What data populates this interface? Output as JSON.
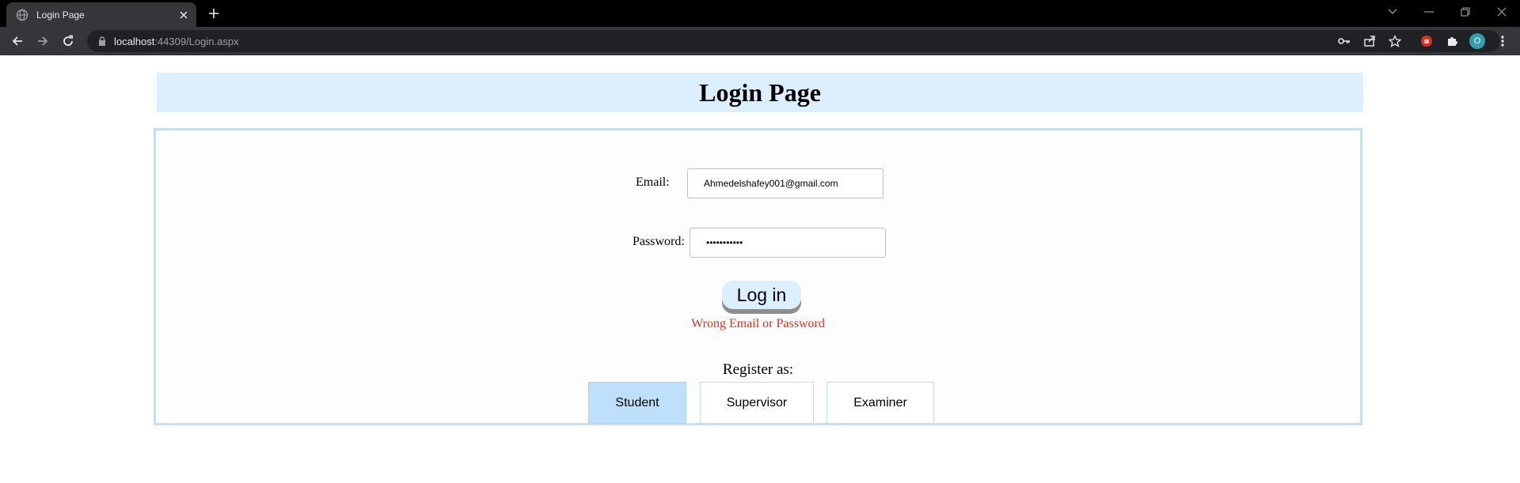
{
  "browser": {
    "tab_title": "Login Page",
    "url_host": "localhost",
    "url_path": ":44309/Login.aspx",
    "profile_initial": "O"
  },
  "page": {
    "title": "Login Page"
  },
  "form": {
    "email_label": "Email:",
    "email_value": "Ahmedelshafey001@gmail.com",
    "password_label": "Password:",
    "password_value": "•••••••••••",
    "login_label": "Log in",
    "error_message": "Wrong Email or Password"
  },
  "register": {
    "label": "Register as:",
    "options": [
      "Student",
      "Supervisor",
      "Examiner"
    ],
    "selected": "Student"
  },
  "colors": {
    "header_bg": "#dcefff",
    "panel_border": "#c7def2",
    "error": "#e0301e",
    "selected_option": "#bfe0fb"
  },
  "icons": {
    "tab": "globe-icon",
    "back": "back-arrow-icon",
    "forward": "forward-arrow-icon",
    "reload": "reload-icon",
    "key": "key-icon",
    "share": "share-icon",
    "star": "star-icon",
    "extension": "puzzle-icon",
    "menu": "kebab-menu-icon"
  }
}
